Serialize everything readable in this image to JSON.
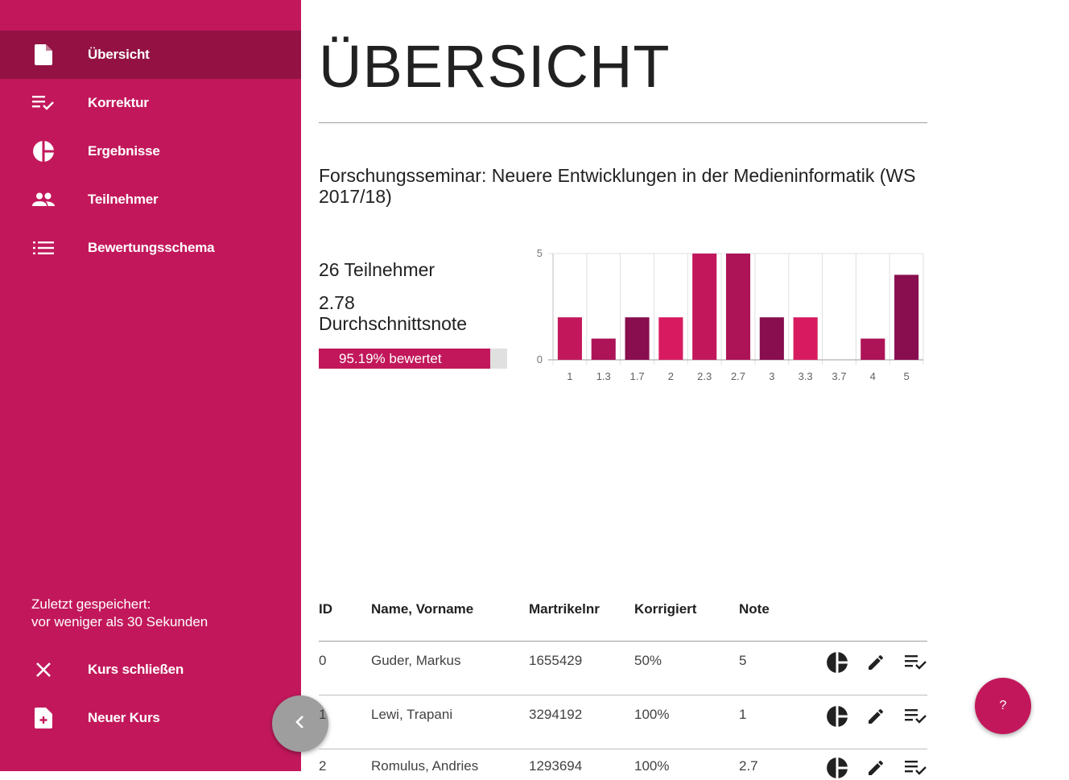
{
  "sidebar": {
    "items": [
      {
        "label": "Übersicht",
        "icon": "document-icon",
        "active": true
      },
      {
        "label": "Korrektur",
        "icon": "playlist-check-icon",
        "active": false
      },
      {
        "label": "Ergebnisse",
        "icon": "pie-chart-icon",
        "active": false
      },
      {
        "label": "Teilnehmer",
        "icon": "people-icon",
        "active": false
      },
      {
        "label": "Bewertungsschema",
        "icon": "list-icon",
        "active": false
      }
    ],
    "saved_line1": "Zuletzt gespeichert:",
    "saved_line2": "vor weniger als 30 Sekunden",
    "bottom_items": [
      {
        "label": "Kurs schließen",
        "icon": "close-icon"
      },
      {
        "label": "Neuer Kurs",
        "icon": "new-file-icon"
      }
    ]
  },
  "main": {
    "title": "ÜBERSICHT",
    "course_title": "Forschungsseminar: Neuere Entwicklungen in der Medieninformatik (WS 2017/18)",
    "participants": "26 Teilnehmer",
    "average_value": "2.78",
    "average_label": "Durchschnittsnote",
    "progress_label": "95.19% bewertet",
    "progress_percent": 95.19
  },
  "chart_data": {
    "type": "bar",
    "categories": [
      "1",
      "1.3",
      "1.7",
      "2",
      "2.3",
      "2.7",
      "3",
      "3.3",
      "3.7",
      "4",
      "5"
    ],
    "values": [
      2,
      1,
      2,
      2,
      5,
      5,
      2,
      2,
      0,
      1,
      4
    ],
    "ylim": [
      0,
      5
    ],
    "yticks": [
      "0",
      "5"
    ],
    "grid": true,
    "colors": [
      "#c2185b",
      "#ad1457",
      "#880e4f",
      "#d81b60",
      "#c2185b",
      "#ad1457",
      "#880e4f",
      "#d81b60",
      "#c2185b",
      "#ad1457",
      "#880e4f"
    ]
  },
  "table": {
    "headers": [
      "ID",
      "Name, Vorname",
      "Martrikelnr",
      "Korrigiert",
      "Note"
    ],
    "rows": [
      {
        "id": "0",
        "name": "Guder, Markus",
        "nr": "1655429",
        "korrigiert": "50%",
        "note": "5"
      },
      {
        "id": "1",
        "name": "Lewi, Trapani",
        "nr": "3294192",
        "korrigiert": "100%",
        "note": "1"
      },
      {
        "id": "2",
        "name": "Romulus, Andries",
        "nr": "1293694",
        "korrigiert": "100%",
        "note": "2.7"
      }
    ]
  },
  "help_label": "?",
  "colors": {
    "accent": "#c2185b",
    "accent_dark": "#931243",
    "fab_gray": "#9e9e9e"
  }
}
